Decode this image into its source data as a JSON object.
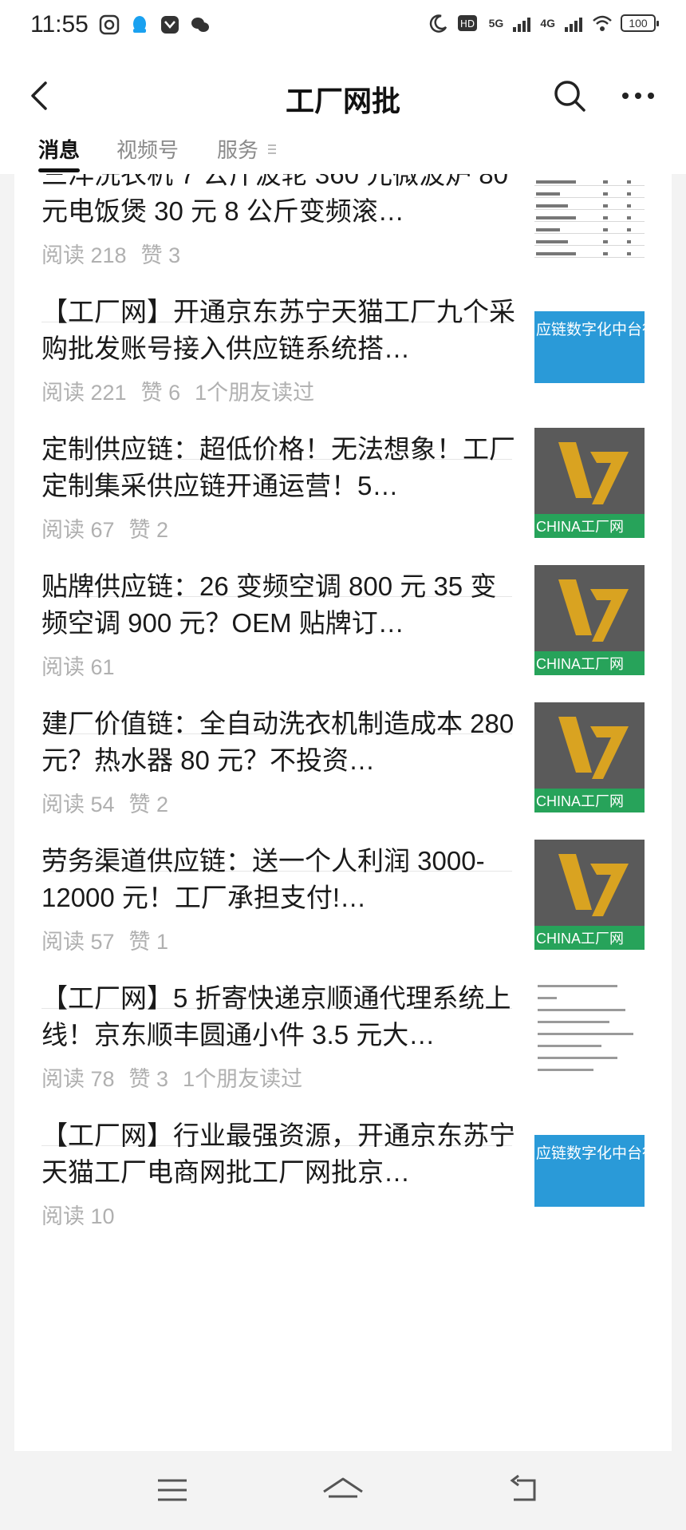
{
  "status": {
    "time": "11:55",
    "battery": "100",
    "network1": "5G",
    "network2": "4G"
  },
  "header": {
    "title": "工厂网批"
  },
  "tabs": [
    {
      "label": "消息",
      "active": true
    },
    {
      "label": "视频号",
      "active": false
    },
    {
      "label": "服务",
      "active": false
    }
  ],
  "articles": [
    {
      "title": "三洋洗衣机 7 公斤波轮 360 元微波炉 80 元电饭煲 30 元 8 公斤变频滚…",
      "reads": "阅读 218",
      "likes": "赞 3",
      "friends": "",
      "thumb": "table"
    },
    {
      "title": "【工厂网】开通京东苏宁天猫工厂九个采购批发账号接入供应链系统搭…",
      "reads": "阅读 221",
      "likes": "赞 6",
      "friends": "1个朋友读过",
      "thumb": "blue",
      "thumb_text": "应链数字化中台行"
    },
    {
      "title": "定制供应链：超低价格！无法想象！工厂定制集采供应链开通运营！5…",
      "reads": "阅读 67",
      "likes": "赞 2",
      "friends": "",
      "thumb": "logo",
      "thumb_text": "CHINA工厂网"
    },
    {
      "title": "贴牌供应链：26 变频空调 800 元 35 变频空调 900 元？OEM 贴牌订…",
      "reads": "阅读 61",
      "likes": "",
      "friends": "",
      "thumb": "logo",
      "thumb_text": "CHINA工厂网"
    },
    {
      "title": "建厂价值链：全自动洗衣机制造成本 280 元？热水器 80 元？不投资…",
      "reads": "阅读 54",
      "likes": "赞 2",
      "friends": "",
      "thumb": "logo",
      "thumb_text": "CHINA工厂网"
    },
    {
      "title": "劳务渠道供应链：送一个人利润 3000-12000 元！工厂承担支付!…",
      "reads": "阅读 57",
      "likes": "赞 1",
      "friends": "",
      "thumb": "logo",
      "thumb_text": "CHINA工厂网"
    },
    {
      "title": "【工厂网】5 折寄快递京顺通代理系统上线！京东顺丰圆通小件 3.5 元大…",
      "reads": "阅读 78",
      "likes": "赞 3",
      "friends": "1个朋友读过",
      "thumb": "list"
    },
    {
      "title": "【工厂网】行业最强资源，开通京东苏宁天猫工厂电商网批工厂网批京…",
      "reads": "阅读 10",
      "likes": "",
      "friends": "",
      "thumb": "blue",
      "thumb_text": "应链数字化中台行"
    }
  ]
}
